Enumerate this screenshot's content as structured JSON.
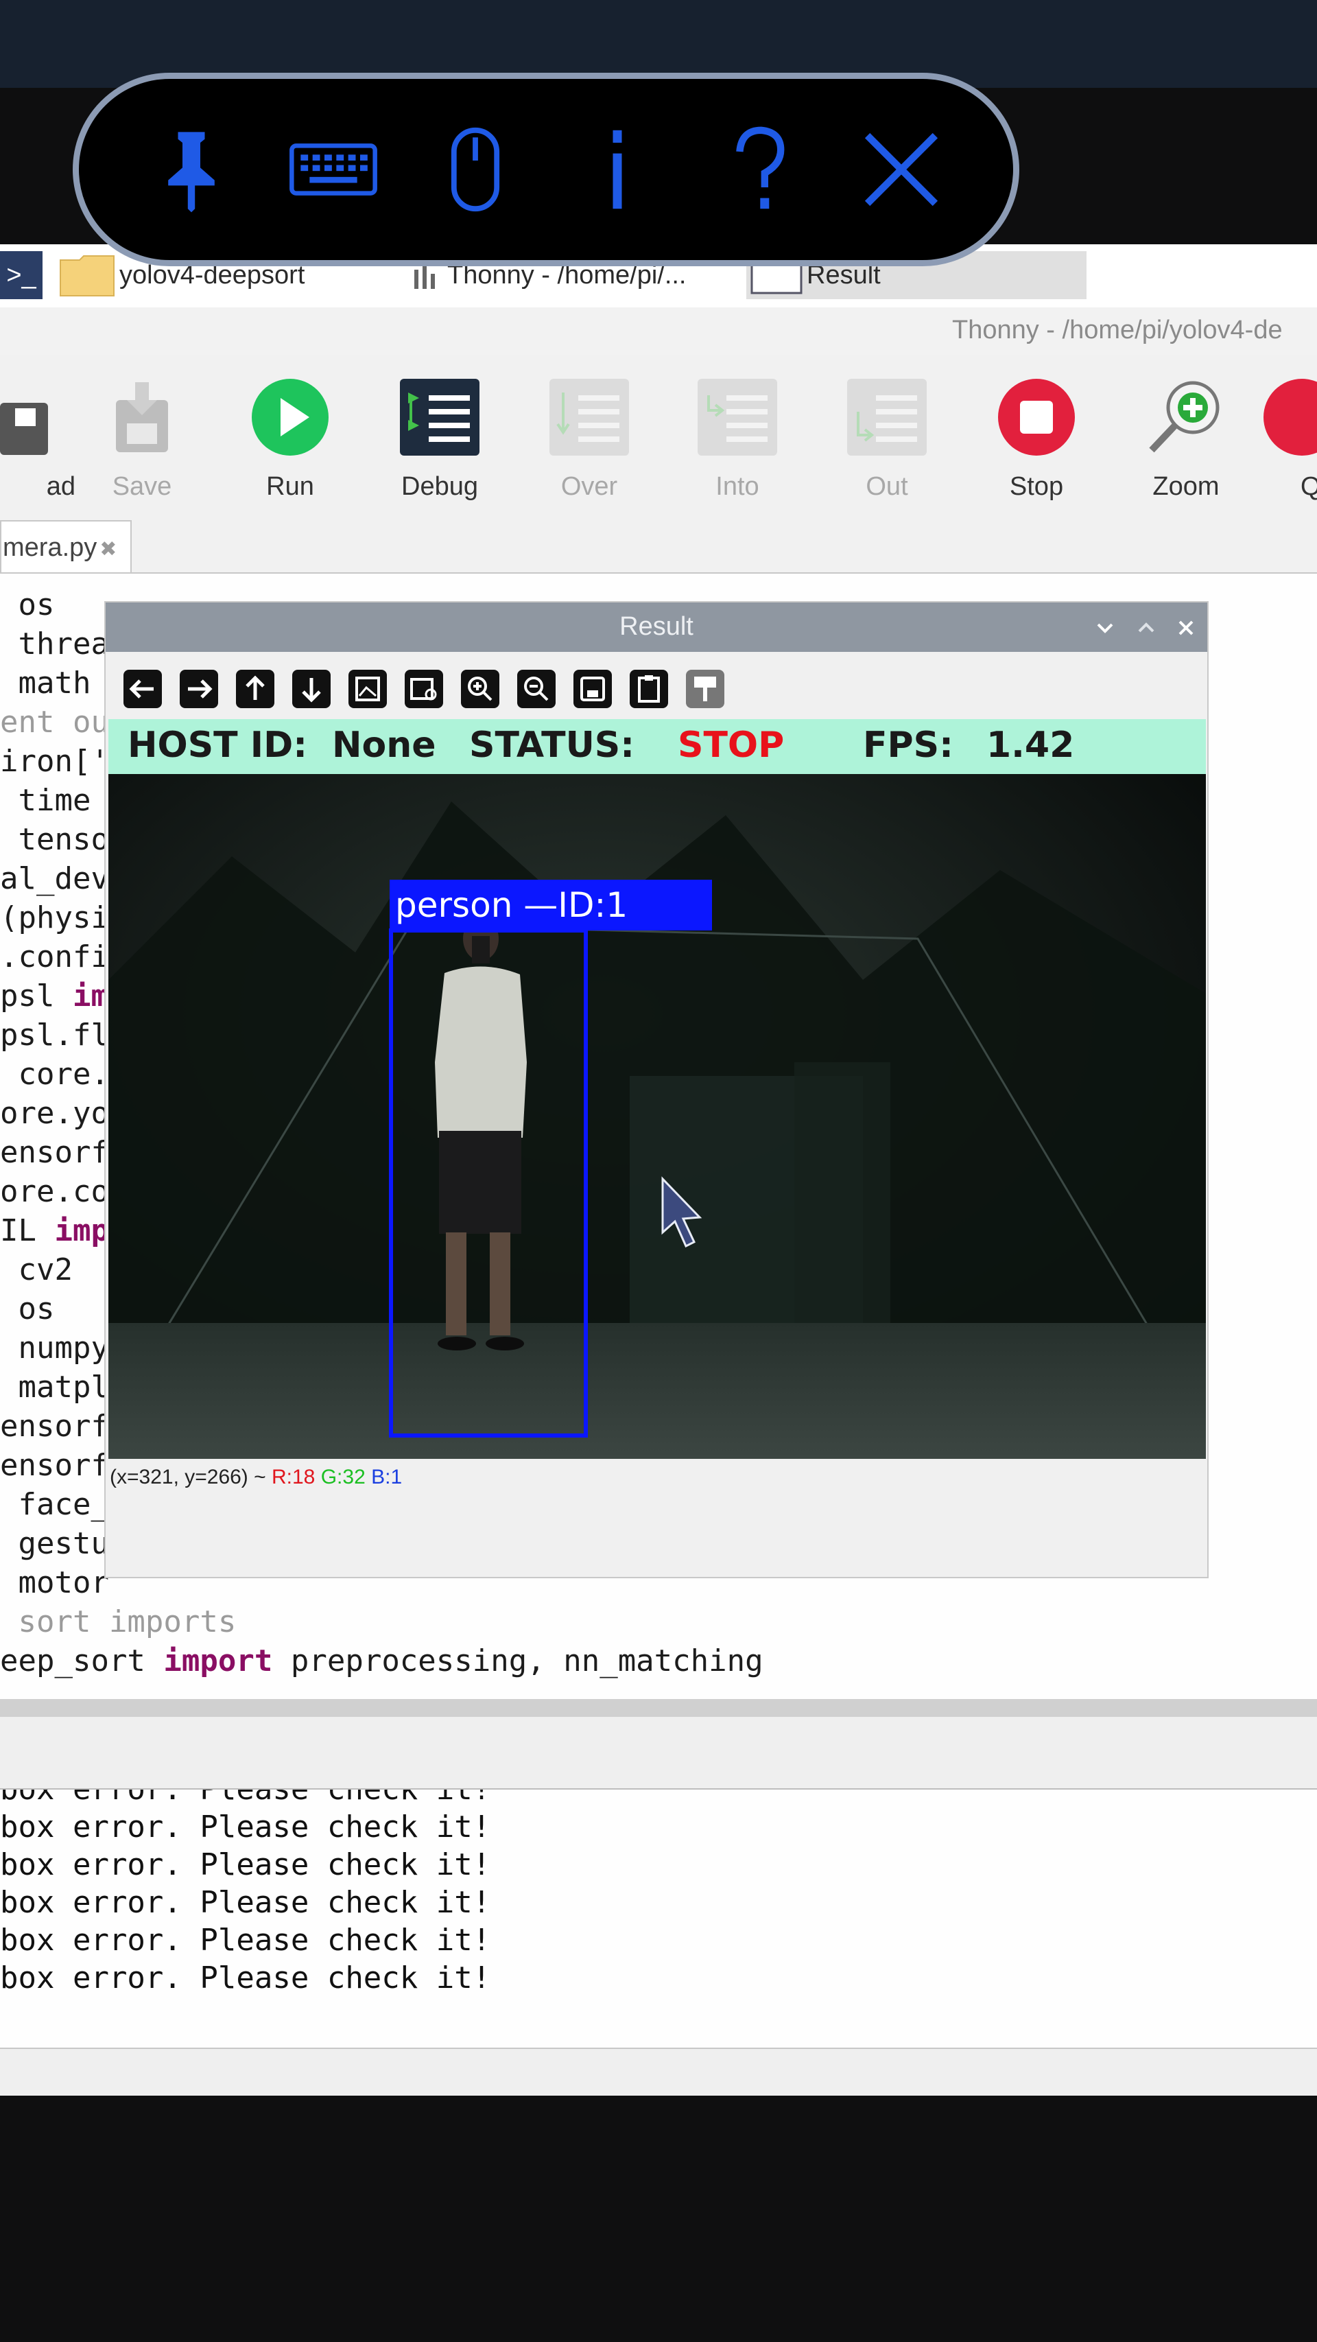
{
  "vnc_toolbar": {
    "buttons": [
      {
        "icon": "pin-icon"
      },
      {
        "icon": "keyboard-icon"
      },
      {
        "icon": "mouse-icon"
      },
      {
        "icon": "info-icon",
        "label": "i"
      },
      {
        "icon": "help-icon",
        "label": "?"
      },
      {
        "icon": "close-icon"
      }
    ],
    "color": "#1f5ae6"
  },
  "taskbar": {
    "terminal_label": ">_",
    "folder_label": "yolov4-deepsort",
    "thonny_label": "Thonny  -  /home/pi/...",
    "result_label": "Result"
  },
  "thonny": {
    "title": "Thonny  -  /home/pi/yolov4-de",
    "toolbar": {
      "load": "ad",
      "save": "Save",
      "run": "Run",
      "debug": "Debug",
      "over": "Over",
      "into": "Into",
      "out": "Out",
      "stop": "Stop",
      "zoom": "Zoom",
      "quit": "Q"
    },
    "tab_label": "mera.py",
    "tab_close": "✖"
  },
  "editor": {
    "lines": [
      " os",
      " threa",
      " math",
      "ent ou",
      "iron['",
      " time",
      " tenso",
      "al_dev",
      "(physi",
      ".confi",
      "psl ",
      "psl.fl",
      " core.",
      "ore.yo",
      "ensorf",
      "ore.co",
      "IL ",
      " cv2",
      " os",
      " numpy",
      " matpl",
      "ensorf",
      "ensorf",
      " face_",
      " gestu",
      " motor",
      " sort imports",
      "eep_sort "
    ],
    "kw_line10": "im",
    "kw_line16": "imp",
    "kw_line27": "import",
    "line27_rest": " preprocessing, nn_matching"
  },
  "shell": {
    "lines": [
      "box error. Please check it!",
      "box error. Please check it!",
      "box error. Please check it!",
      "box error. Please check it!",
      "box error. Please check it!",
      "box error. Please check it!"
    ]
  },
  "result_window": {
    "title": "Result",
    "hud": {
      "host_label": "HOST ID:",
      "host_value": "None",
      "status_label": "STATUS:",
      "status_value": "STOP",
      "fps_label": "FPS:",
      "fps_value": "1.42",
      "status_color": "#e8121b"
    },
    "detection": {
      "label": "person —ID:1",
      "box_color": "#0b17ff"
    },
    "pixel_status": {
      "coords": "(x=321, y=266) ~",
      "r": "R:18",
      "g": "G:32",
      "b": "B:1"
    }
  }
}
